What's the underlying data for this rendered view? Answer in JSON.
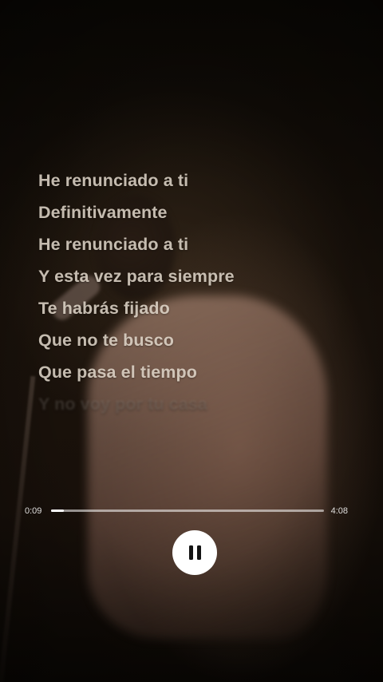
{
  "lyrics": {
    "lines": [
      "He renunciado a ti",
      "Definitivamente",
      "He renunciado a ti",
      "Y esta vez para siempre",
      "Te habrás fijado",
      "Que no te busco",
      "Que pasa el tiempo",
      "Y no voy por tu casa"
    ]
  },
  "player": {
    "elapsed": "0:09",
    "total": "4:08",
    "progress_fraction": 0.036,
    "control_icon": "pause-icon",
    "accent_color": "#ffffff"
  }
}
